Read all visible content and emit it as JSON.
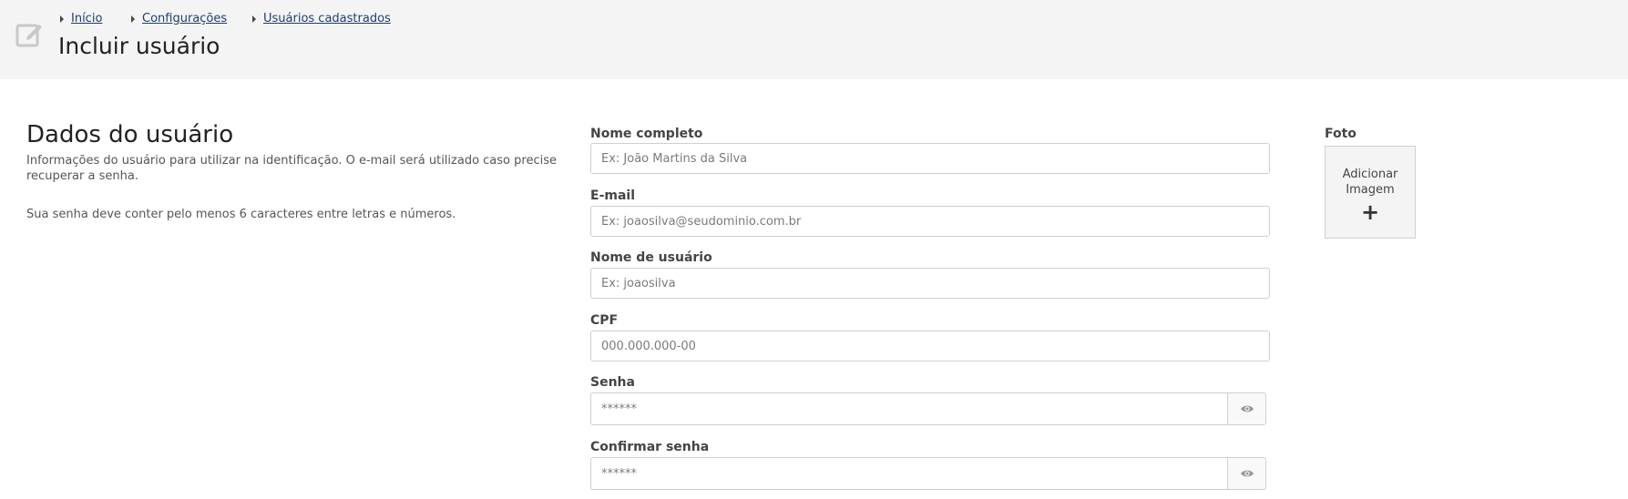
{
  "header": {
    "breadcrumb": [
      {
        "label": "Início"
      },
      {
        "label": "Configurações"
      },
      {
        "label": "Usuários cadastrados"
      }
    ],
    "title": "Incluir usuário",
    "icon": "edit-icon"
  },
  "section": {
    "title": "Dados do usuário",
    "description": "Informações do usuário para utilizar na identificação. O e-mail será utilizado caso precise recuperar a senha.",
    "note": "Sua senha deve conter pelo menos 6 caracteres entre letras e números."
  },
  "form": {
    "full_name": {
      "label": "Nome completo",
      "placeholder": "Ex: João Martins da Silva",
      "value": ""
    },
    "email": {
      "label": "E-mail",
      "placeholder": "Ex: joaosilva@seudominio.com.br",
      "value": ""
    },
    "username": {
      "label": "Nome de usuário",
      "placeholder": "Ex: joaosilva",
      "value": ""
    },
    "cpf": {
      "label": "CPF",
      "placeholder": "000.000.000-00",
      "value": ""
    },
    "password": {
      "label": "Senha",
      "placeholder": "******",
      "value": "",
      "toggle_icon": "eye-icon"
    },
    "confirm_password": {
      "label": "Confirmar senha",
      "placeholder": "******",
      "value": "",
      "toggle_icon": "eye-icon"
    }
  },
  "photo": {
    "label": "Foto",
    "button_text": "Adicionar Imagem",
    "icon_text": "+"
  },
  "colors": {
    "header_bg": "#f4f4f4",
    "link": "#1f3e6e",
    "border": "#cfcfcf"
  }
}
